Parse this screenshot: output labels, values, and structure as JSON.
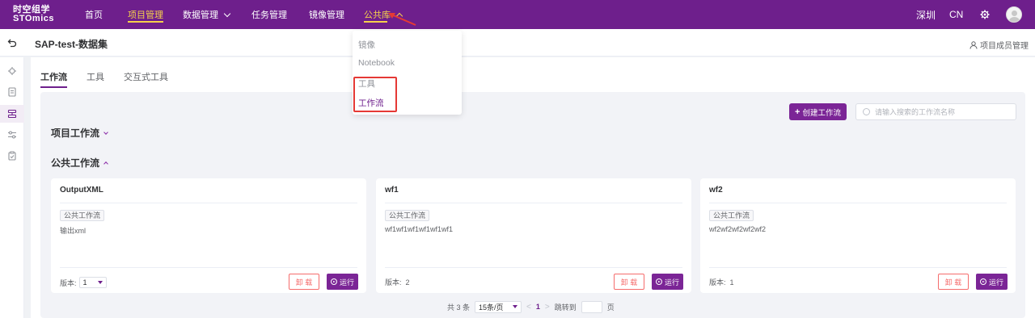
{
  "topbar": {
    "logo_line1": "时空组学",
    "logo_line2": "STOmics",
    "nav": [
      {
        "label": "首页"
      },
      {
        "label": "项目管理"
      },
      {
        "label": "数据管理"
      },
      {
        "label": "任务管理"
      },
      {
        "label": "镜像管理"
      },
      {
        "label": "公共库"
      }
    ],
    "region": "深圳",
    "lang": "CN"
  },
  "dropdown": {
    "items": [
      "镜像",
      "Notebook",
      "工具",
      "工作流"
    ]
  },
  "header": {
    "project_title": "SAP-test-数据集",
    "members_label": "项目成员管理"
  },
  "tabs": [
    "工作流",
    "工具",
    "交互式工具"
  ],
  "toolbar": {
    "create_label": "创建工作流",
    "search_placeholder": "请输入搜索的工作流名称"
  },
  "sections": {
    "project": "项目工作流",
    "public": "公共工作流"
  },
  "cards": [
    {
      "name": "OutputXML",
      "tag": "公共工作流",
      "desc": "输出xml",
      "version_label": "版本:",
      "version": "1",
      "unload": "卸 载",
      "run": "运行"
    },
    {
      "name": "wf1",
      "tag": "公共工作流",
      "desc": "wf1wf1wf1wf1wf1wf1",
      "version_label": "版本:",
      "version": "2",
      "unload": "卸 载",
      "run": "运行"
    },
    {
      "name": "wf2",
      "tag": "公共工作流",
      "desc": "wf2wf2wf2wf2wf2",
      "version_label": "版本:",
      "version": "1",
      "unload": "卸 载",
      "run": "运行"
    }
  ],
  "pager": {
    "total": "共 3 条",
    "page_size": "15条/页",
    "current": "1",
    "jump_label": "跳转到",
    "page_suffix": "页"
  },
  "colors": {
    "brand": "#6e1f8c",
    "accent": "#f5d14b",
    "danger": "#f56c6c",
    "annotation": "#e53935"
  }
}
